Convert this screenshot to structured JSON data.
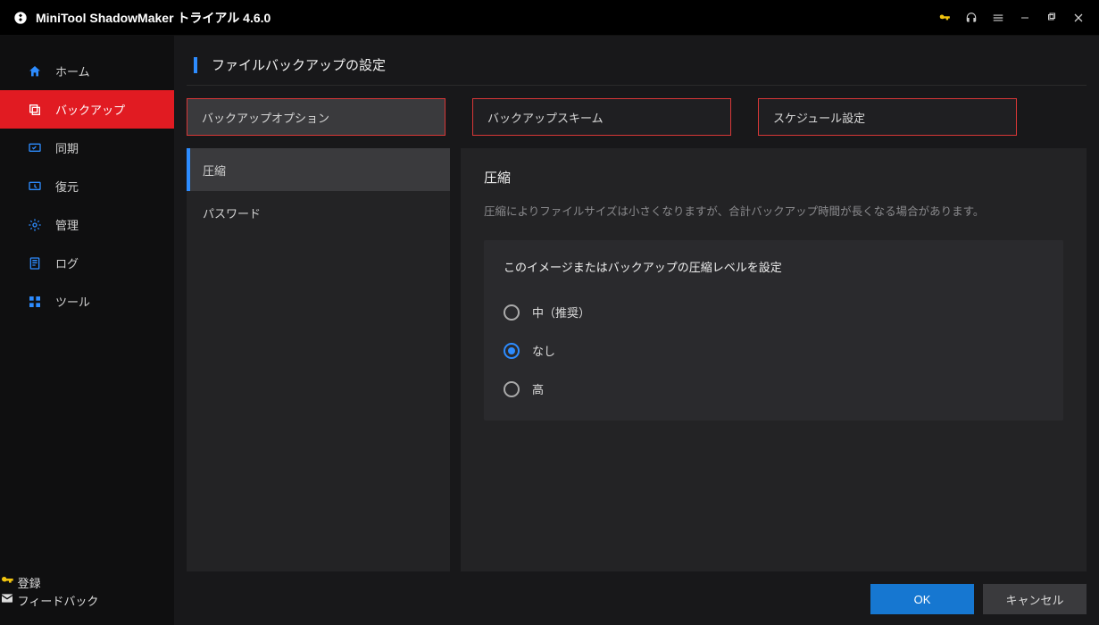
{
  "title": "MiniTool ShadowMaker トライアル 4.6.0",
  "sidebar": {
    "items": [
      {
        "label": "ホーム"
      },
      {
        "label": "バックアップ"
      },
      {
        "label": "同期"
      },
      {
        "label": "復元"
      },
      {
        "label": "管理"
      },
      {
        "label": "ログ"
      },
      {
        "label": "ツール"
      }
    ],
    "bottom": [
      {
        "label": "登録"
      },
      {
        "label": "フィードバック"
      }
    ]
  },
  "page": {
    "title": "ファイルバックアップの設定",
    "tabs": [
      {
        "label": "バックアップオプション"
      },
      {
        "label": "バックアップスキーム"
      },
      {
        "label": "スケジュール設定"
      }
    ],
    "side_options": [
      {
        "label": "圧縮"
      },
      {
        "label": "パスワード"
      }
    ],
    "panel": {
      "heading": "圧縮",
      "desc": "圧縮によりファイルサイズは小さくなりますが、合計バックアップ時間が長くなる場合があります。",
      "group_title": "このイメージまたはバックアップの圧縮レベルを設定",
      "radios": [
        {
          "label": "中（推奨）"
        },
        {
          "label": "なし"
        },
        {
          "label": "高"
        }
      ],
      "selected_radio": 1
    },
    "ok": "OK",
    "cancel": "キャンセル"
  }
}
